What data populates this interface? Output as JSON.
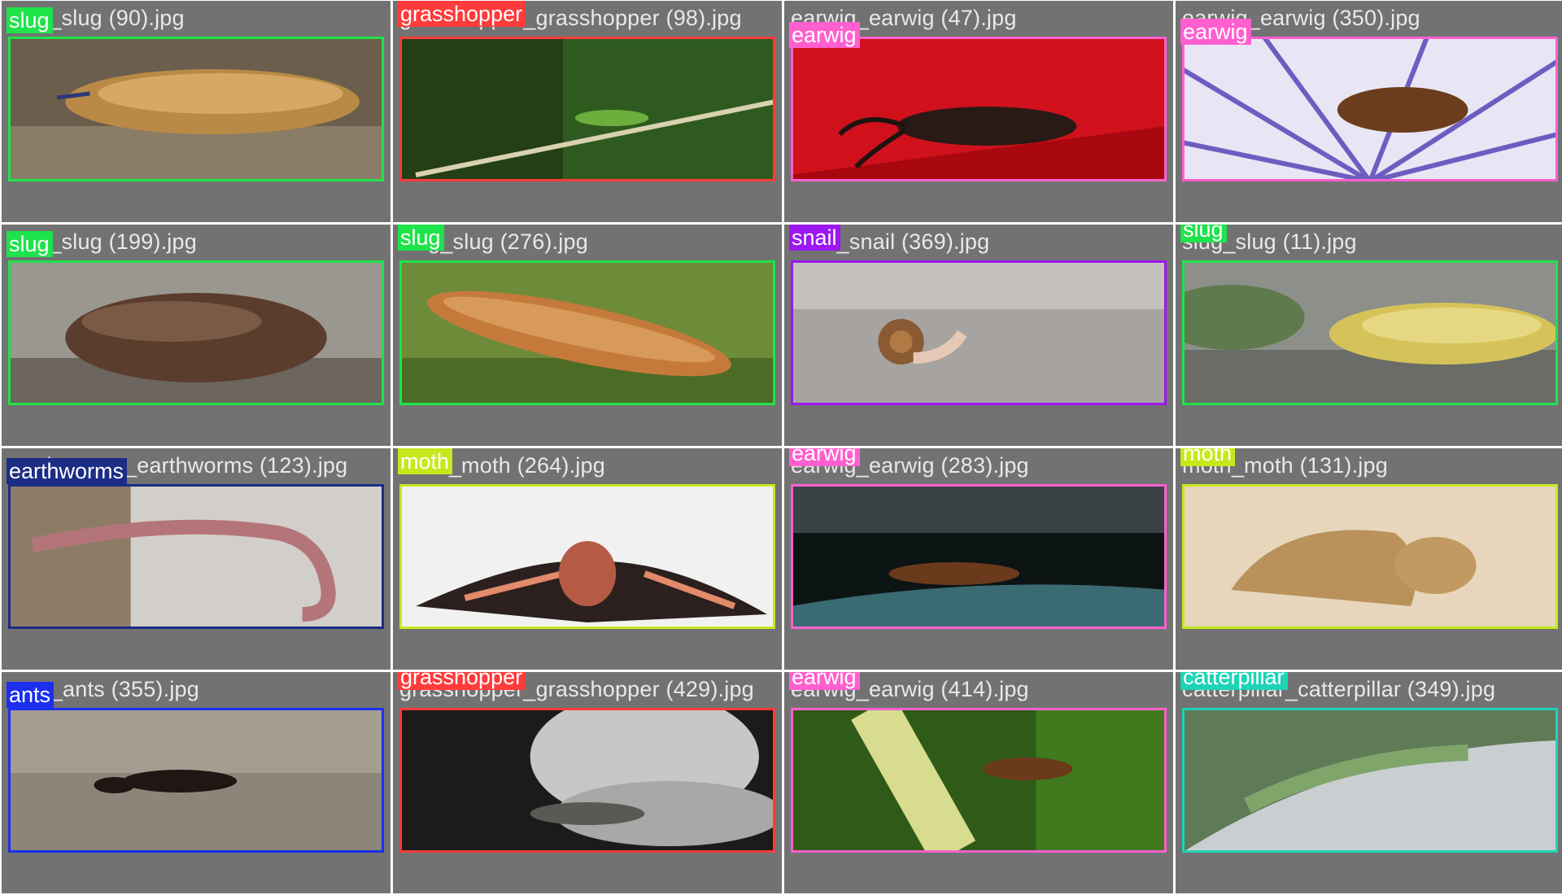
{
  "colors": {
    "slug": "#1ee34a",
    "grasshopper": "#ff3b3b",
    "earwig": "#ff5fcf",
    "snail": "#9b18f0",
    "earthworms": "#1c2d86",
    "moth": "#c6e81c",
    "ants": "#1c2ff0",
    "catterpillar": "#1fd3b6"
  },
  "tiles": [
    {
      "filename": "slug_slug (90).jpg",
      "class": "slug"
    },
    {
      "filename": "grasshopper_grasshopper (98).jpg",
      "class": "grasshopper"
    },
    {
      "filename": "earwig_earwig (47).jpg",
      "class": "earwig"
    },
    {
      "filename": "earwig_earwig (350).jpg",
      "class": "earwig"
    },
    {
      "filename": "slug_slug (199).jpg",
      "class": "slug"
    },
    {
      "filename": "slug_slug (276).jpg",
      "class": "slug"
    },
    {
      "filename": "snail_snail (369).jpg",
      "class": "snail"
    },
    {
      "filename": "slug_slug (11).jpg",
      "class": "slug"
    },
    {
      "filename": "earthworms_earthworms (123).jpg",
      "class": "earthworms"
    },
    {
      "filename": "moth_moth (264).jpg",
      "class": "moth"
    },
    {
      "filename": "earwig_earwig (283).jpg",
      "class": "earwig"
    },
    {
      "filename": "moth_moth (131).jpg",
      "class": "moth"
    },
    {
      "filename": "ants_ants (355).jpg",
      "class": "ants"
    },
    {
      "filename": "grasshopper_grasshopper (429).jpg",
      "class": "grasshopper"
    },
    {
      "filename": "earwig_earwig (414).jpg",
      "class": "earwig"
    },
    {
      "filename": "catterpillar_catterpillar (349).jpg",
      "class": "catterpillar"
    }
  ]
}
